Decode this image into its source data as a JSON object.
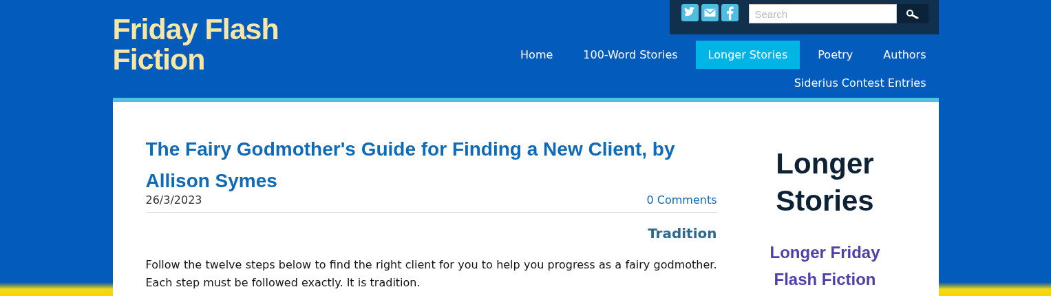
{
  "site_title": "Friday Flash Fiction",
  "social": [
    {
      "kind": "twitter"
    },
    {
      "kind": "email"
    },
    {
      "kind": "facebook"
    }
  ],
  "search": {
    "placeholder": "Search"
  },
  "nav": [
    {
      "label": "Home",
      "selected": false
    },
    {
      "label": "100-Word Stories",
      "selected": false
    },
    {
      "label": "Longer Stories",
      "selected": true
    },
    {
      "label": "Poetry",
      "selected": false
    },
    {
      "label": "Authors",
      "selected": false
    },
    {
      "label": "Siderius Contest Entries",
      "selected": false
    }
  ],
  "post": {
    "title": "The Fairy Godmother's Guide for Finding a New Client, by Allison Symes",
    "date": "26/3/2023",
    "comments": "0 Comments",
    "heading": "Tradition",
    "paragraph": "Follow the twelve steps below to find the right client for you to help you progress as a fairy godmother. Each step must be followed exactly. It is tradition."
  },
  "sidebar": {
    "heading": "Longer Stories",
    "subheading": "Longer Friday Flash Fiction"
  }
}
